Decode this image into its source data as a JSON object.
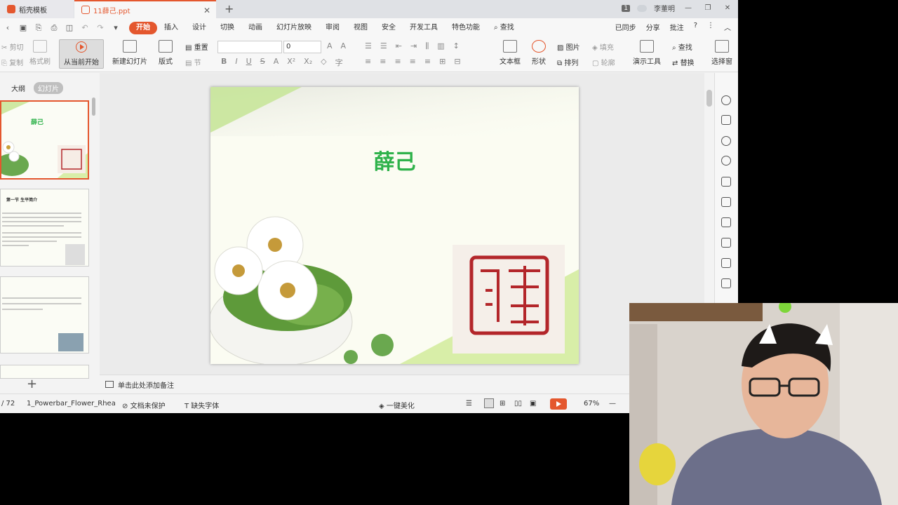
{
  "tabs": {
    "home_tab": "稻壳模板",
    "file_tab": "11薛己.ppt",
    "close": "✕",
    "add": "+"
  },
  "titlebar": {
    "badge": "1",
    "user": "李董明"
  },
  "menu": {
    "items": [
      "开始",
      "插入",
      "设计",
      "切换",
      "动画",
      "幻灯片放映",
      "审阅",
      "视图",
      "安全",
      "开发工具",
      "特色功能"
    ],
    "search": "查找",
    "right": [
      "已同步",
      "分享",
      "批注"
    ]
  },
  "toolbar": {
    "cut": "剪切",
    "copy": "复制",
    "format_painter": "格式刷",
    "from_current": "从当前开始",
    "new_slide": "新建幻灯片",
    "layout": "版式",
    "reset": "重置",
    "section": "节",
    "font_size": "0",
    "textbox": "文本框",
    "shape": "形状",
    "picture": "图片",
    "fill": "填充",
    "arrange": "排列",
    "outline": "轮廓",
    "present_tools": "演示工具",
    "find": "查找",
    "replace": "替换",
    "select": "选择窗"
  },
  "left_panel": {
    "outline_tab": "大纲",
    "slides_tab": "幻灯片",
    "thumb1_title": "薛己",
    "thumb2_heading": "第一节 生平简介",
    "add_button": "+"
  },
  "slide": {
    "title": "薛己",
    "title_color": "#2fb24b",
    "seal_color": "#b3262a"
  },
  "notes": {
    "placeholder": "单击此处添加备注"
  },
  "status": {
    "page": "/ 72",
    "theme": "1_Powerbar_Flower_Rhea",
    "protect": "文档未保护",
    "missing_font": "缺失字体",
    "beautify": "一键美化",
    "zoom": "67%"
  },
  "colors": {
    "accent": "#e4572e",
    "title_green": "#2fb24b"
  }
}
